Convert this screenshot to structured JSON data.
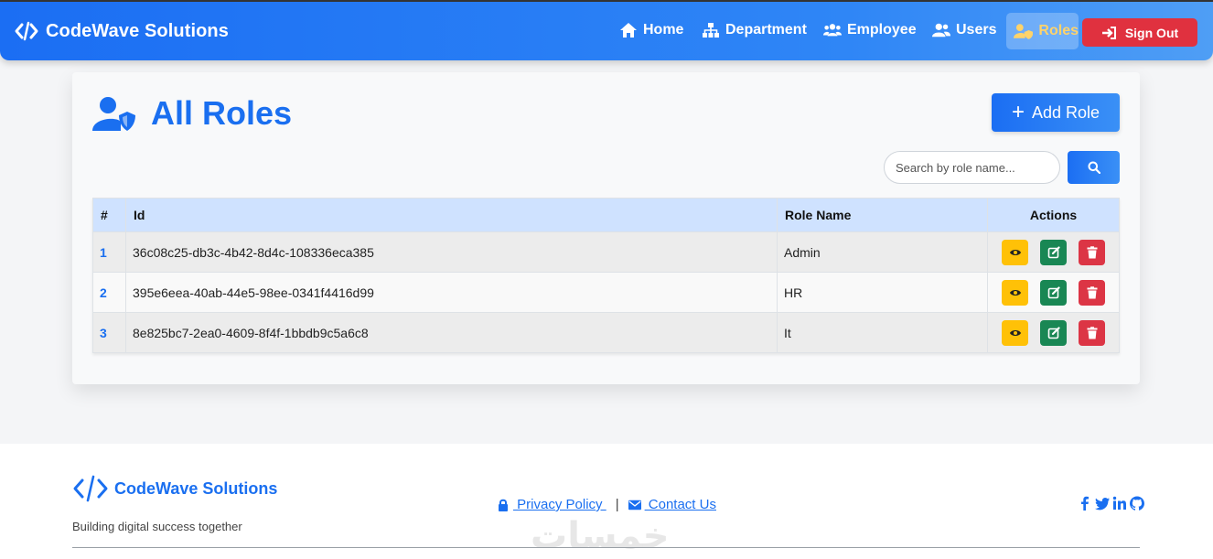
{
  "navbar": {
    "brand": "CodeWave Solutions",
    "items": [
      {
        "label": "Home",
        "icon": "home-icon"
      },
      {
        "label": "Department",
        "icon": "sitemap-icon"
      },
      {
        "label": "Employee",
        "icon": "people-group-icon"
      },
      {
        "label": "Users",
        "icon": "users-icon"
      },
      {
        "label": "Roles",
        "icon": "user-shield-icon",
        "active": true
      }
    ],
    "signout_label": "Sign Out",
    "colors": {
      "bar": "#1b6ef3",
      "active_text": "#ffd36a",
      "signout": "#e0313f"
    }
  },
  "main": {
    "title": "All Roles",
    "title_icon": "user-shield-icon",
    "add_button_label": "Add Role",
    "search": {
      "placeholder": "Search by role name...",
      "value": ""
    },
    "table": {
      "headers": {
        "num": "#",
        "id": "Id",
        "name": "Role Name",
        "actions": "Actions"
      },
      "rows": [
        {
          "num": "1",
          "id": "36c08c25-db3c-4b42-8d4c-108336eca385",
          "name": "Admin"
        },
        {
          "num": "2",
          "id": "395e6eea-40ab-44e5-98ee-0341f4416d99",
          "name": "HR"
        },
        {
          "num": "3",
          "id": "8e825bc7-2ea0-4609-8f4f-1bbdb9c5a6c8",
          "name": "It"
        }
      ],
      "action_icons": [
        "eye-icon",
        "edit-icon",
        "trash-icon"
      ],
      "action_colors": {
        "view": "#ffc107",
        "edit": "#198754",
        "delete": "#dc3545"
      }
    }
  },
  "footer": {
    "brand": "CodeWave Solutions",
    "tagline": "Building digital success together",
    "privacy_label": " Privacy Policy ",
    "separator": "|",
    "contact_label": " Contact Us",
    "social_icons": [
      "facebook-icon",
      "twitter-icon",
      "linkedin-icon",
      "github-icon"
    ],
    "watermark": "خمسات"
  }
}
